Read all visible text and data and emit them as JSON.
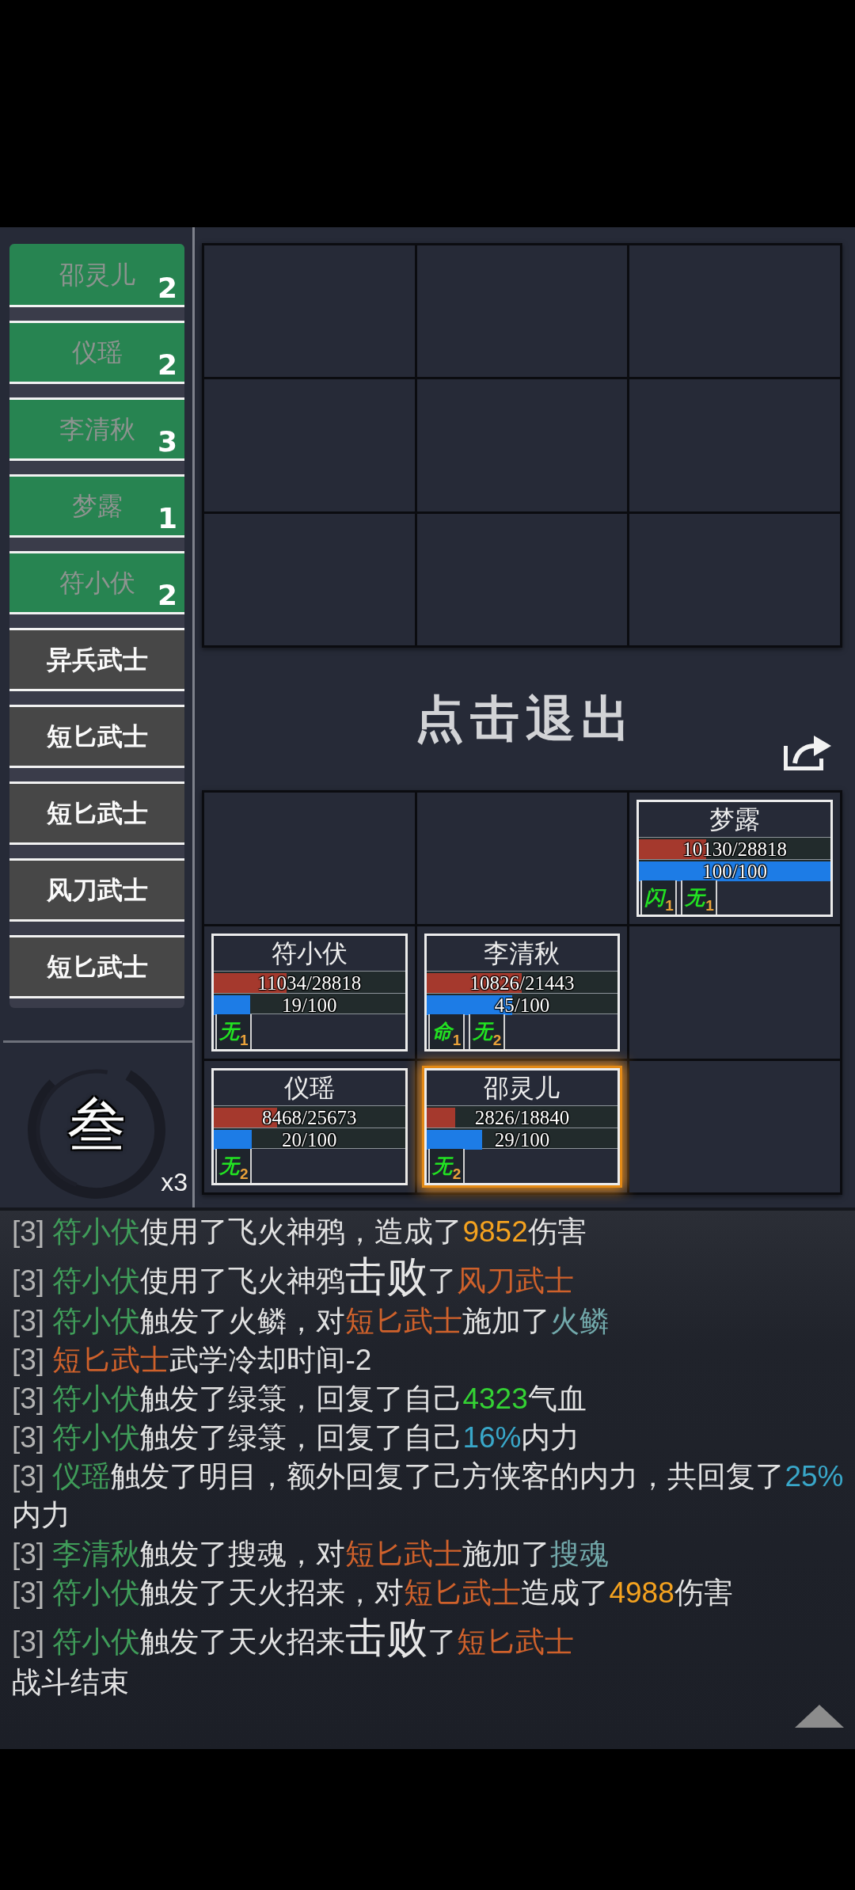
{
  "roster": {
    "items": [
      {
        "kind": "ally",
        "name": "邵灵儿",
        "count": "2"
      },
      {
        "kind": "ally",
        "name": "仪瑶",
        "count": "2"
      },
      {
        "kind": "ally",
        "name": "李清秋",
        "count": "3"
      },
      {
        "kind": "ally",
        "name": "梦露",
        "count": "1"
      },
      {
        "kind": "ally",
        "name": "符小伏",
        "count": "2"
      },
      {
        "kind": "enemy",
        "name": "异兵武士"
      },
      {
        "kind": "enemy",
        "name": "短匕武士"
      },
      {
        "kind": "enemy",
        "name": "短匕武士"
      },
      {
        "kind": "enemy",
        "name": "风刀武士"
      },
      {
        "kind": "enemy",
        "name": "短匕武士"
      }
    ]
  },
  "round_emblem": {
    "numeral": "叁",
    "multiplier": "x3"
  },
  "enemy_grid": {
    "cells": [
      {
        "kind": "empty"
      },
      {
        "kind": "empty"
      },
      {
        "kind": "empty"
      },
      {
        "kind": "empty"
      },
      {
        "kind": "empty"
      },
      {
        "kind": "empty"
      },
      {
        "kind": "empty"
      },
      {
        "kind": "empty"
      },
      {
        "kind": "empty"
      }
    ]
  },
  "exit_prompt": "点击退出",
  "ally_grid": {
    "cells": [
      {
        "kind": "empty"
      },
      {
        "kind": "empty"
      },
      {
        "kind": "unit",
        "name": "梦露",
        "selected": false,
        "hp": {
          "text": "10130/28818",
          "level": 0.35
        },
        "mp": {
          "text": "100/100",
          "level": 1
        },
        "buffs": [
          {
            "glyph": "闪",
            "stacks": "1"
          },
          {
            "glyph": "无",
            "stacks": "1"
          }
        ]
      },
      {
        "kind": "unit",
        "name": "符小伏",
        "selected": false,
        "hp": {
          "text": "11034/28818",
          "level": 0.38
        },
        "mp": {
          "text": "19/100",
          "level": 0.19
        },
        "buffs": [
          {
            "glyph": "无",
            "stacks": "1"
          }
        ]
      },
      {
        "kind": "unit",
        "name": "李清秋",
        "selected": false,
        "hp": {
          "text": "10826/21443",
          "level": 0.5
        },
        "mp": {
          "text": "45/100",
          "level": 0.45
        },
        "buffs": [
          {
            "glyph": "命",
            "stacks": "1"
          },
          {
            "glyph": "无",
            "stacks": "2"
          }
        ]
      },
      {
        "kind": "empty"
      },
      {
        "kind": "unit",
        "name": "仪瑶",
        "selected": false,
        "hp": {
          "text": "8468/25673",
          "level": 0.33
        },
        "mp": {
          "text": "20/100",
          "level": 0.2
        },
        "buffs": [
          {
            "glyph": "无",
            "stacks": "2"
          }
        ]
      },
      {
        "kind": "unit",
        "name": "邵灵儿",
        "selected": true,
        "hp": {
          "text": "2826/18840",
          "level": 0.15
        },
        "mp": {
          "text": "29/100",
          "level": 0.29
        },
        "buffs": [
          {
            "glyph": "无",
            "stacks": "2"
          }
        ]
      },
      {
        "kind": "empty"
      }
    ]
  },
  "battle_log": {
    "lines": [
      {
        "round": "[3]",
        "segments": [
          {
            "kind": "ally",
            "text": "符小伏"
          },
          {
            "kind": "text",
            "text": "使用了飞火神鸦，造成了"
          },
          {
            "kind": "damage",
            "text": "9852"
          },
          {
            "kind": "text",
            "text": "伤害"
          }
        ]
      },
      {
        "round": "[3]",
        "segments": [
          {
            "kind": "ally",
            "text": "符小伏"
          },
          {
            "kind": "text",
            "text": "使用了飞火神鸦"
          },
          {
            "kind": "emphasis",
            "text": "击败"
          },
          {
            "kind": "text",
            "text": "了"
          },
          {
            "kind": "enemy",
            "text": "风刀武士"
          }
        ]
      },
      {
        "round": "[3]",
        "segments": [
          {
            "kind": "ally",
            "text": "符小伏"
          },
          {
            "kind": "text",
            "text": "触发了火鳞，对"
          },
          {
            "kind": "enemy",
            "text": "短匕武士"
          },
          {
            "kind": "text",
            "text": "施加了"
          },
          {
            "kind": "skill",
            "text": "火鳞"
          }
        ]
      },
      {
        "round": "[3]",
        "segments": [
          {
            "kind": "enemy",
            "text": "短匕武士"
          },
          {
            "kind": "text",
            "text": "武学冷却时间-2"
          }
        ]
      },
      {
        "round": "[3]",
        "segments": [
          {
            "kind": "ally",
            "text": "符小伏"
          },
          {
            "kind": "text",
            "text": "触发了绿箓，回复了自己"
          },
          {
            "kind": "heal",
            "text": "4323"
          },
          {
            "kind": "text",
            "text": "气血"
          }
        ]
      },
      {
        "round": "[3]",
        "segments": [
          {
            "kind": "ally",
            "text": "符小伏"
          },
          {
            "kind": "text",
            "text": "触发了绿箓，回复了自己"
          },
          {
            "kind": "percent",
            "text": "16%"
          },
          {
            "kind": "text",
            "text": "内力"
          }
        ]
      },
      {
        "round": "[3]",
        "segments": [
          {
            "kind": "ally",
            "text": "仪瑶"
          },
          {
            "kind": "text",
            "text": "触发了明目，额外回复了己方侠客的内力，共回复了"
          },
          {
            "kind": "percent",
            "text": "25%"
          },
          {
            "kind": "text",
            "text": "内力"
          }
        ]
      },
      {
        "round": "[3]",
        "segments": [
          {
            "kind": "ally",
            "text": "李清秋"
          },
          {
            "kind": "text",
            "text": "触发了搜魂，对"
          },
          {
            "kind": "enemy",
            "text": "短匕武士"
          },
          {
            "kind": "text",
            "text": "施加了"
          },
          {
            "kind": "skill",
            "text": "搜魂"
          }
        ]
      },
      {
        "round": "[3]",
        "segments": [
          {
            "kind": "ally",
            "text": "符小伏"
          },
          {
            "kind": "text",
            "text": "触发了天火招来，对"
          },
          {
            "kind": "enemy",
            "text": "短匕武士"
          },
          {
            "kind": "text",
            "text": "造成了"
          },
          {
            "kind": "damage",
            "text": "4988"
          },
          {
            "kind": "text",
            "text": "伤害"
          }
        ]
      },
      {
        "round": "[3]",
        "segments": [
          {
            "kind": "ally",
            "text": "符小伏"
          },
          {
            "kind": "text",
            "text": "触发了天火招来"
          },
          {
            "kind": "emphasis",
            "text": "击败"
          },
          {
            "kind": "text",
            "text": "了"
          },
          {
            "kind": "enemy",
            "text": "短匕武士"
          }
        ]
      },
      {
        "segments": [
          {
            "kind": "text",
            "text": "战斗结束"
          }
        ]
      }
    ]
  }
}
